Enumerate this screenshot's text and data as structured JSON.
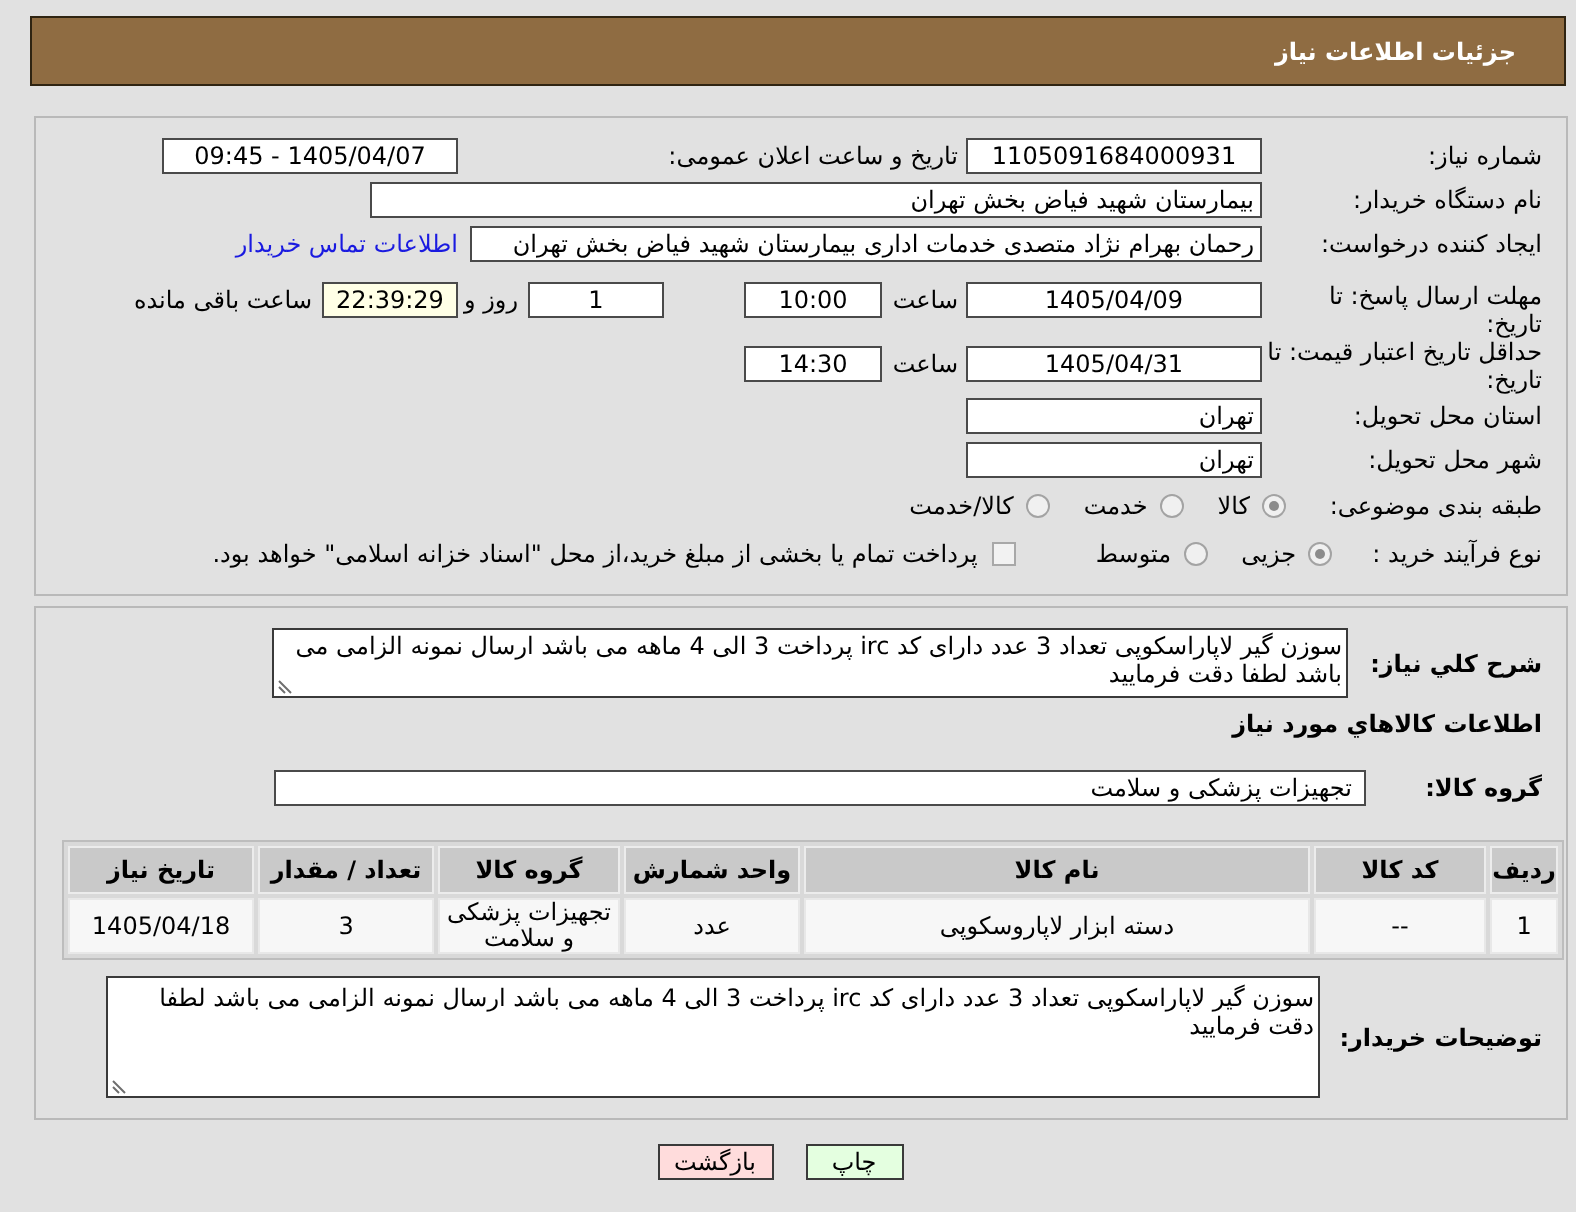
{
  "header": {
    "title": "جزئیات اطلاعات نیاز"
  },
  "need_info": {
    "need_number": {
      "label": "شماره نیاز:",
      "value": "1105091684000931"
    },
    "announce_datetime": {
      "label": "تاریخ و ساعت اعلان عمومی:",
      "value": "1405/04/07 - 09:45"
    },
    "buyer_org": {
      "label": "نام دستگاه خریدار:",
      "value": "بیمارستان شهید فیاض بخش تهران"
    },
    "requester": {
      "label": "ایجاد کننده درخواست:",
      "value": "رحمان بهرام نژاد متصدی خدمات اداری بیمارستان شهید فیاض بخش تهران",
      "contact_link": "اطلاعات تماس خریدار"
    },
    "response_deadline": {
      "label": "مهلت ارسال پاسخ: تا تاریخ:",
      "date": "1405/04/09",
      "time_label": "ساعت",
      "time": "10:00",
      "days": "1",
      "days_label": "روز و",
      "remaining": "22:39:29",
      "remaining_label": "ساعت باقی مانده"
    },
    "price_validity": {
      "label": "حداقل تاریخ اعتبار قیمت: تا تاریخ:",
      "date": "1405/04/31",
      "time_label": "ساعت",
      "time": "14:30"
    },
    "delivery_province": {
      "label": "استان محل تحویل:",
      "value": "تهران"
    },
    "delivery_city": {
      "label": "شهر محل تحویل:",
      "value": "تهران"
    },
    "category": {
      "label": "طبقه بندی موضوعی:",
      "options": [
        {
          "label": "کالا",
          "selected": true
        },
        {
          "label": "خدمت",
          "selected": false
        },
        {
          "label": "کالا/خدمت",
          "selected": false
        }
      ]
    },
    "purchase_process": {
      "label": "نوع فرآیند خرید :",
      "options": [
        {
          "label": "جزیی",
          "selected": true
        },
        {
          "label": "متوسط",
          "selected": false
        }
      ],
      "treasury_payment": {
        "label": "پرداخت تمام یا بخشی از مبلغ خرید،از محل \"اسناد خزانه اسلامی\" خواهد بود.",
        "checked": false
      }
    }
  },
  "goods": {
    "description": {
      "label": "شرح کلي نیاز:",
      "value": "سوزن گیر لاپاراسکوپی تعداد 3 عدد دارای کد irc پرداخت 3 الی 4 ماهه می باشد ارسال نمونه الزامی می باشد لطفا دقت فرمایید"
    },
    "section_title": "اطلاعات کالاهاي مورد نیاز",
    "group": {
      "label": "گروه کالا:",
      "value": "تجهیزات پزشکی و سلامت"
    },
    "table": {
      "columns": [
        "ردیف",
        "کد کالا",
        "نام کالا",
        "واحد شمارش",
        "گروه کالا",
        "تعداد / مقدار",
        "تاریخ نیاز"
      ],
      "rows": [
        [
          "1",
          "--",
          "دسته ابزار لاپاروسکوپی",
          "عدد",
          "تجهیزات پزشکی و سلامت",
          "3",
          "1405/04/18"
        ]
      ]
    },
    "buyer_notes": {
      "label": "توضیحات خریدار:",
      "value": "سوزن گیر لاپاراسکوپی تعداد 3 عدد دارای کد irc پرداخت 3 الی 4 ماهه می باشد ارسال نمونه الزامی می باشد لطفا دقت فرمایید"
    }
  },
  "buttons": [
    {
      "kind": "print",
      "label": "چاپ"
    },
    {
      "kind": "back",
      "label": "بازگشت"
    }
  ]
}
